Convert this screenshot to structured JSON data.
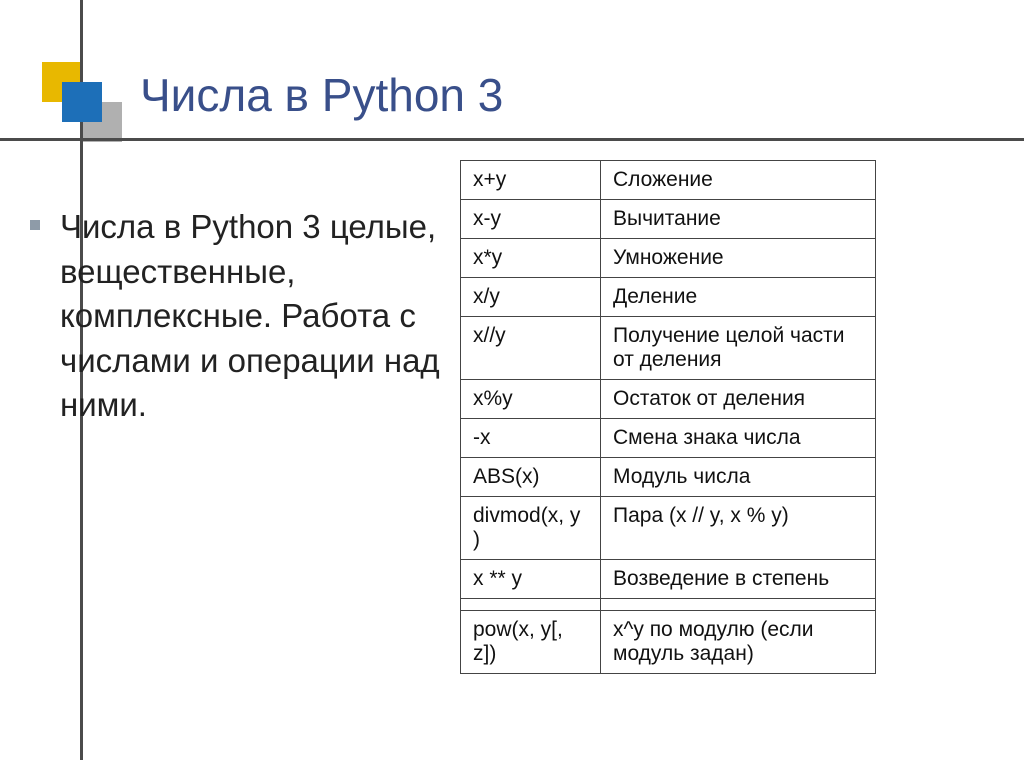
{
  "title": "Числа в Python 3",
  "body": "Числа в Python 3 целые, вещественные, комплексные. Работа с числами и операции над ними.",
  "rows": [
    {
      "op": "x+y",
      "desc": "Сложение"
    },
    {
      "op": "x-y",
      "desc": "Вычитание"
    },
    {
      "op": "x*y",
      "desc": "Умножение"
    },
    {
      "op": "x/y",
      "desc": "Деление"
    },
    {
      "op": "x//y",
      "desc": "Получение целой части от деления"
    },
    {
      "op": "x%y",
      "desc": "Остаток от деления"
    },
    {
      "op": "-x",
      "desc": "Смена знака числа"
    },
    {
      "op": "ABS(x)",
      "desc": "Модуль числа"
    },
    {
      "op": "divmod(x, y )",
      "desc": "Пара (x // y, x % y)"
    },
    {
      "op": "x ** y",
      "desc": "Возведение в степень"
    }
  ],
  "last": {
    "op": "pow(x, y[, z])",
    "desc": "x^y по модулю (если модуль задан)"
  }
}
